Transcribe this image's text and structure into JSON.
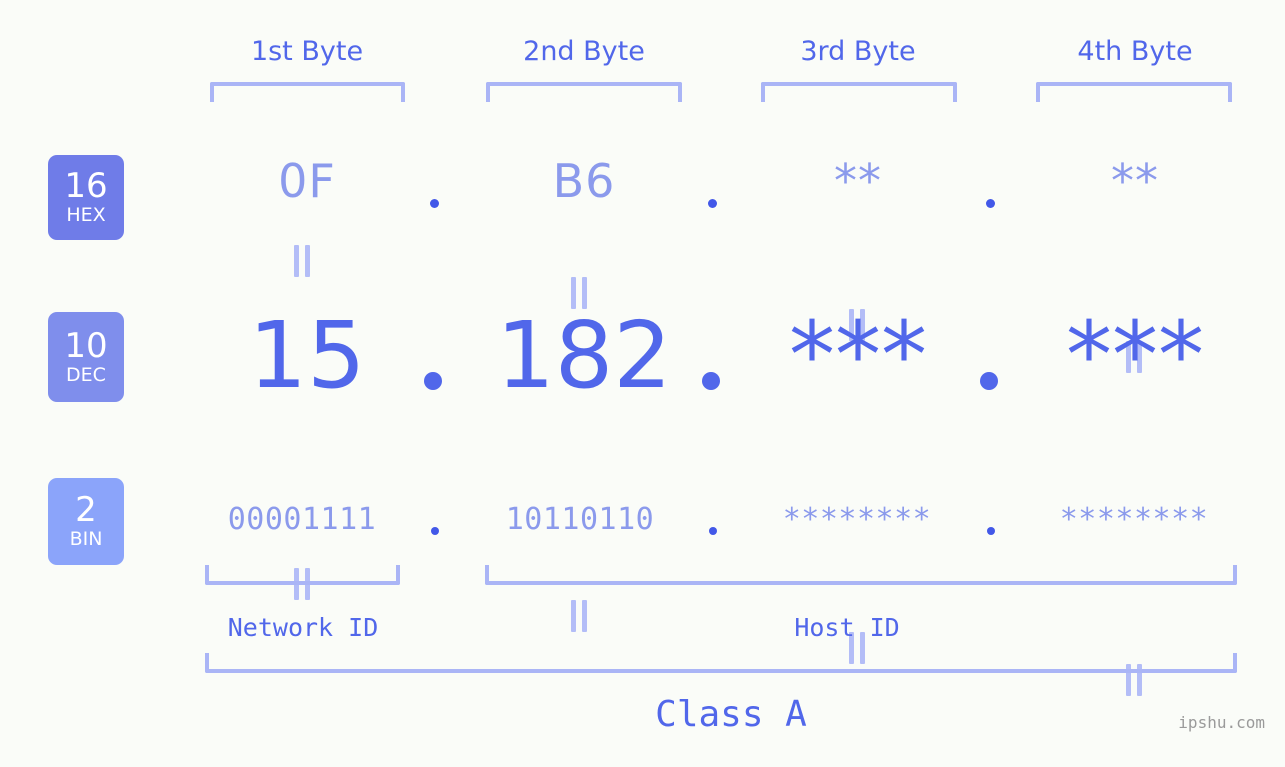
{
  "meta": {
    "background_color": "#fafcf8",
    "accent_dark": "#5167ea",
    "accent_light": "#8b9aec",
    "bracket_color": "#aab5f6",
    "watermark": "ipshu.com"
  },
  "byte_headers": [
    {
      "label": "1st Byte"
    },
    {
      "label": "2nd Byte"
    },
    {
      "label": "3rd Byte"
    },
    {
      "label": "4th Byte"
    }
  ],
  "rows": [
    {
      "key": "hex",
      "badge": {
        "number": "16",
        "label": "HEX",
        "color": "#6f7ce8"
      },
      "values": [
        "0F",
        "B6",
        "**",
        "**"
      ],
      "separator": "."
    },
    {
      "key": "dec",
      "badge": {
        "number": "10",
        "label": "DEC",
        "color": "#7f8eec"
      },
      "values": [
        "15",
        "182",
        "***",
        "***"
      ],
      "separator": "."
    },
    {
      "key": "bin",
      "badge": {
        "number": "2",
        "label": "BIN",
        "color": "#8ba4fa"
      },
      "values": [
        "00001111",
        "10110110",
        "********",
        "********"
      ],
      "separator": "."
    }
  ],
  "segments": {
    "network_id": "Network ID",
    "host_id": "Host ID",
    "class": "Class A"
  },
  "icons": {
    "equals": "equals-mark",
    "dot": "dot-separator"
  }
}
